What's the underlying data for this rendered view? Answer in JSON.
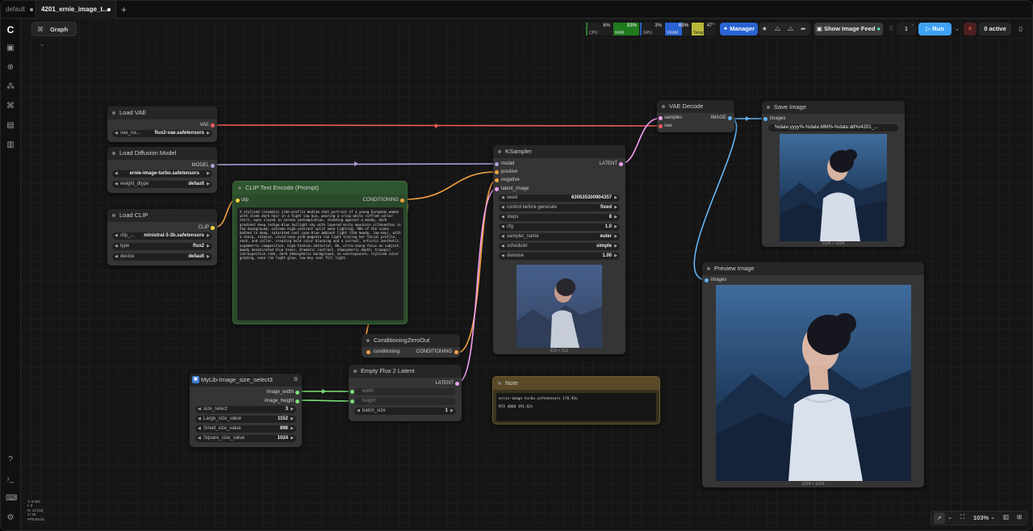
{
  "tabs": {
    "t1": "default",
    "t2": "4201_ernie_image_t...",
    "new": "+"
  },
  "toolbar": {
    "graph": "Graph",
    "cpu_val": "6%",
    "cpu_lbl": "CPU",
    "ram_val": "83%",
    "ram_lbl": "RAM",
    "gpu_val": "3%",
    "gpu_lbl": "GPU",
    "vram_val": "65%",
    "vram_lbl": "VRAM",
    "temp_val": "47°",
    "temp_lbl": "Temp",
    "manager": "Manager",
    "show_feed": "Show Image Feed",
    "queue": "1",
    "run": "Run",
    "active": "0 active"
  },
  "colors": {
    "link_vae": "#f05a5a",
    "link_model": "#b39ddb",
    "link_conditioning": "#f6a441",
    "link_latent": "#f39ff0",
    "link_image": "#64b5f6",
    "link_int": "#7be07b",
    "run": "#3ea2f5",
    "manager": "#2a63d3"
  },
  "nodes": {
    "load_vae": {
      "title": "Load VAE",
      "out": "VAE",
      "w_label": "vae_na...",
      "w_value": "flux2-vae.safetensors"
    },
    "load_diffusion": {
      "title": "Load Diffusion Model",
      "out": "MODEL",
      "w1_value": "ernie-image-turbo.safetensors",
      "w2_label": "weight_dtype",
      "w2_value": "default"
    },
    "load_clip": {
      "title": "Load CLIP",
      "out": "CLIP",
      "w1_label": "clip_...",
      "w1_value": "ministral-3-3b.safetensors",
      "w2_label": "type",
      "w2_value": "flux2",
      "w3_label": "device",
      "w3_value": "default"
    },
    "clip_text": {
      "title": "CLIP Text Encode (Prompt)",
      "in": "clip",
      "out": "CONDITIONING",
      "prompt": "A stylized cinematic side-profile medium shot portrait of a young European woman with sleek dark hair in a tight low bun, wearing a crisp white ruffled-collar shirt, eyes closed in serene contemplation, standing against a moody, dark gradient deep indigo-blue twilight sky with layered misty mountain silhouettes in the background, extreme high-contrast split neon lighting: 90% of the scene bathed in deep, saturated cool cyan-blue ambient light (the moody, low-key), with a sharp, intense, vivid neon pink-magenta rim light tracing her facial profile, neck, and collar, creating bold color blocking and a surreal, artistic aesthetic, asymmetric composition, high-fashion editorial, 8k, ultra-sharp focus on subject, moody desaturated blue tones, dramatic contrast, atmospheric depth, tranquil introspective vibe, dark atmospheric background, no overexposure, stylized color grading, neon rim light glow, low-key cool fill light."
    },
    "cond_zero": {
      "title": "ConditioningZeroOut",
      "in": "conditioning",
      "out": "CONDITIONING"
    },
    "ksampler": {
      "title": "KSampler",
      "in1": "model",
      "in2": "positive",
      "in3": "negative",
      "in4": "latent_image",
      "out": "LATENT",
      "w": [
        [
          "seed",
          "630535300904357"
        ],
        [
          "control before generate",
          "fixed"
        ],
        [
          "steps",
          "8"
        ],
        [
          "cfg",
          "1.0"
        ],
        [
          "sampler_name",
          "euler"
        ],
        [
          "scheduler",
          "simple"
        ],
        [
          "denoise",
          "1.00"
        ]
      ],
      "img_label": "512 × 512"
    },
    "vae_decode": {
      "title": "VAE Decode",
      "in1": "samples",
      "in2": "vae",
      "out": "IMAGE"
    },
    "save_image": {
      "title": "Save Image",
      "in": "images",
      "prefix": "%date:yyyy%-%date:MM%-%date:dd%/4201_...",
      "img_label": "1024 × 1024"
    },
    "preview_image": {
      "title": "Preview Image",
      "in": "images",
      "img_label": "1024 × 1024"
    },
    "empty_latent": {
      "title": "Empty Flux 2 Latent",
      "out": "LATENT",
      "in1": "width",
      "in2": "height",
      "w_label": "batch_size",
      "w_value": "1"
    },
    "note": {
      "title": "Note",
      "line1": "ernie-image-turbo.safetensors    176.93s",
      "line2": "RTX 4060  191.62s"
    },
    "mylib": {
      "title": "MyLib-Image_size_select3",
      "out1": "image_width",
      "out2": "image_height",
      "w": [
        [
          "size_select",
          "3"
        ],
        [
          "Large_size_value",
          "1152"
        ],
        [
          "Small_size_value",
          "896"
        ],
        [
          "Square_size_value",
          "1024"
        ]
      ]
    }
  },
  "stats": {
    "l1": "T: 0.00s",
    "l2": "I: 0",
    "l3": "N: 12 [12]",
    "l4": "V: 26",
    "l5": "FPS:60.61"
  },
  "zoom": "103%"
}
